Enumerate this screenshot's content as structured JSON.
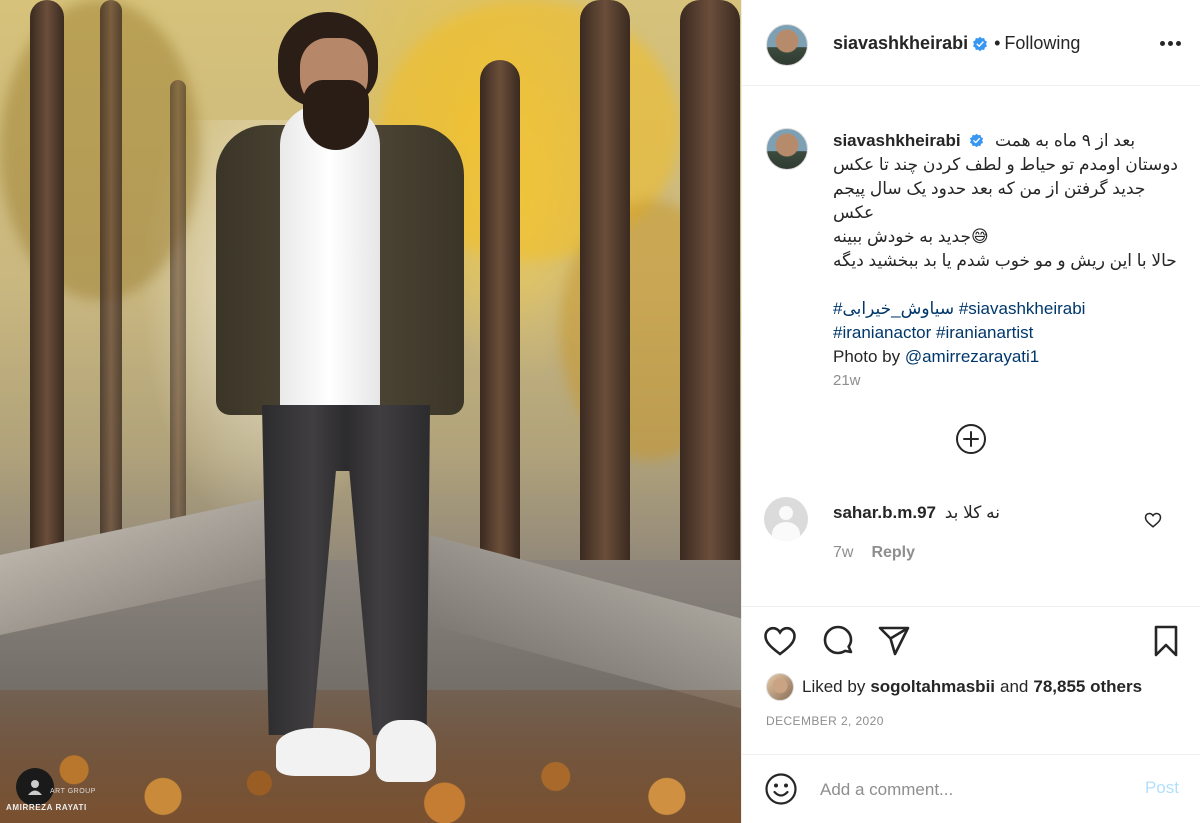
{
  "post": {
    "username": "siavashkheirabi",
    "separator": "•",
    "follow_status": "Following",
    "caption_lines": [
      "بعد از ۹ ماه به همت",
      "دوستان اومدم تو حیاط و لطف کردن چند تا عکس",
      "جدید گرفتن از من که بعد حدود یک سال پیجم عکس",
      "😅جدید به خودش ببینه",
      "حالا با این ریش و مو خوب شدم یا بد ببخشید دیگه",
      ""
    ],
    "hashtags_line1": [
      "#سیاوش_خیرابی",
      "#siavashkheirabi"
    ],
    "hashtags_line2": [
      "#iranianactor",
      "#iranianartist"
    ],
    "photo_by_label": "Photo by",
    "photo_by_handle": "@amirrezarayati1",
    "age": "21w"
  },
  "comment": {
    "username": "sahar.b.m.97",
    "text": "نه کلا بد",
    "age": "7w",
    "reply_label": "Reply"
  },
  "likes": {
    "prefix": "Liked by",
    "liker": "sogoltahmasbii",
    "conj": "and",
    "others": "78,855 others"
  },
  "date": "DECEMBER 2, 2020",
  "composer": {
    "placeholder": "Add a comment...",
    "post_label": "Post"
  },
  "watermark": {
    "line1": "ART GROUP",
    "line2": "AMIRREZA RAYATI"
  },
  "icons": {
    "verified": "verified-badge-icon",
    "more": "more-options-icon",
    "like": "heart-icon",
    "comment": "comment-bubble-icon",
    "share": "paper-plane-icon",
    "save": "bookmark-icon",
    "emoji": "smiley-icon",
    "load_more": "plus-circle-icon"
  },
  "colors": {
    "link": "#00376b",
    "verified": "#3897f0",
    "muted": "#8e8e8e",
    "post_disabled": "#b2dffc"
  }
}
